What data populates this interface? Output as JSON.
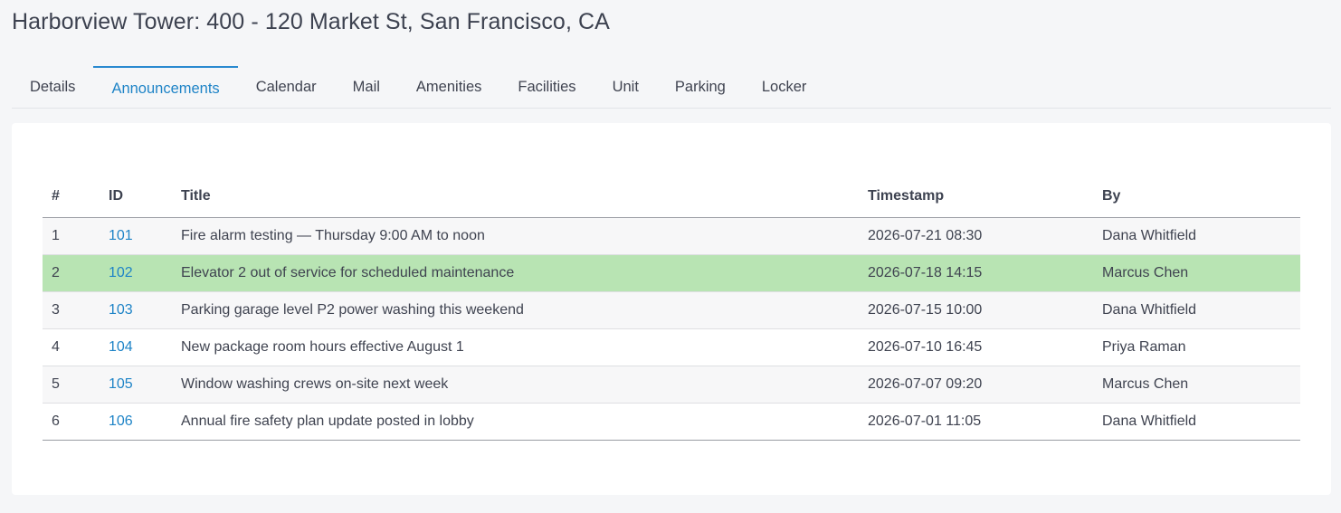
{
  "page": {
    "title": "Harborview Tower: 400 - 120 Market St, San Francisco, CA"
  },
  "tabs": [
    {
      "label": "Details",
      "active": false
    },
    {
      "label": "Announcements",
      "active": true
    },
    {
      "label": "Calendar",
      "active": false
    },
    {
      "label": "Mail",
      "active": false
    },
    {
      "label": "Amenities",
      "active": false
    },
    {
      "label": "Facilities",
      "active": false
    },
    {
      "label": "Unit",
      "active": false
    },
    {
      "label": "Parking",
      "active": false
    },
    {
      "label": "Locker",
      "active": false
    }
  ],
  "colors": {
    "accent": "#1f84c7",
    "highlight_row": "#b8e4b3"
  },
  "table": {
    "headers": {
      "num": "#",
      "id": "ID",
      "title": "Title",
      "timestamp": "Timestamp",
      "by": "By"
    },
    "rows": [
      {
        "num": "1",
        "id": "101",
        "title": "Fire alarm testing — Thursday 9:00 AM to noon",
        "timestamp": "2026-07-21 08:30",
        "by": "Dana Whitfield",
        "highlighted": false
      },
      {
        "num": "2",
        "id": "102",
        "title": "Elevator 2 out of service for scheduled maintenance",
        "timestamp": "2026-07-18 14:15",
        "by": "Marcus Chen",
        "highlighted": true
      },
      {
        "num": "3",
        "id": "103",
        "title": "Parking garage level P2 power washing this weekend",
        "timestamp": "2026-07-15 10:00",
        "by": "Dana Whitfield",
        "highlighted": false
      },
      {
        "num": "4",
        "id": "104",
        "title": "New package room hours effective August 1",
        "timestamp": "2026-07-10 16:45",
        "by": "Priya Raman",
        "highlighted": false
      },
      {
        "num": "5",
        "id": "105",
        "title": "Window washing crews on-site next week",
        "timestamp": "2026-07-07 09:20",
        "by": "Marcus Chen",
        "highlighted": false
      },
      {
        "num": "6",
        "id": "106",
        "title": "Annual fire safety plan update posted in lobby",
        "timestamp": "2026-07-01 11:05",
        "by": "Dana Whitfield",
        "highlighted": false
      }
    ]
  }
}
